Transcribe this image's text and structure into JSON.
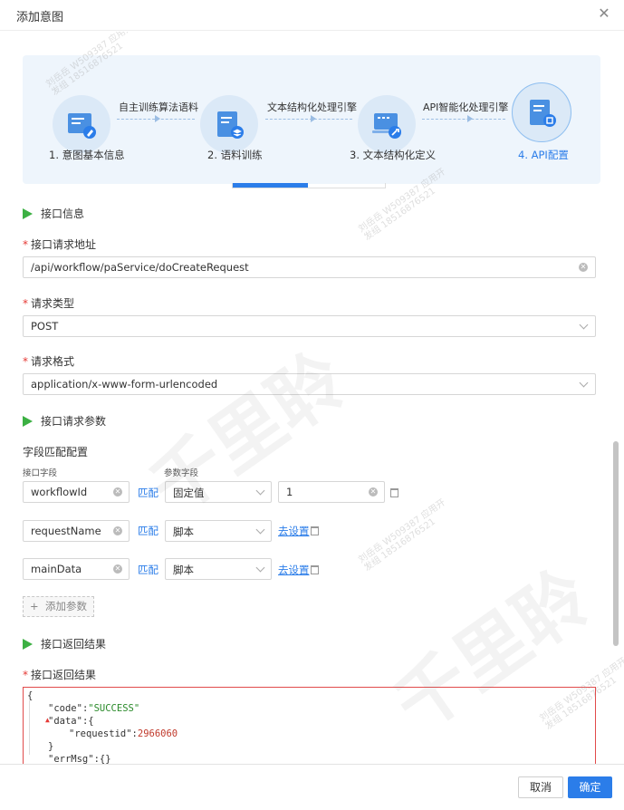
{
  "dialog": {
    "title": "添加意图",
    "close_icon": "close-icon"
  },
  "steps": [
    {
      "label": "1. 意图基本信息",
      "icon": "edit-document-icon",
      "active": false
    },
    {
      "label": "2. 语料训练",
      "icon": "layers-document-icon",
      "active": false
    },
    {
      "label": "3. 文本结构化定义",
      "icon": "laptop-tool-icon",
      "active": false
    },
    {
      "label": "4. API配置",
      "icon": "api-document-icon",
      "active": true
    }
  ],
  "connectors": [
    "自主训练算法语料",
    "文本结构化处理引擎",
    "API智能化处理引擎"
  ],
  "sections": {
    "interface_info": "接口信息",
    "request_params": "接口请求参数",
    "response": "接口返回结果"
  },
  "form": {
    "url_label": "接口请求地址",
    "url_value": "/api/workflow/paService/doCreateRequest",
    "type_label": "请求类型",
    "type_value": "POST",
    "format_label": "请求格式",
    "format_value": "application/x-www-form-urlencoded"
  },
  "mapping": {
    "title": "字段匹配配置",
    "col_interface": "接口字段",
    "col_param": "参数字段",
    "match_label": "匹配",
    "rows": [
      {
        "field": "workflowId",
        "param_type": "固定值",
        "value": "1",
        "link": ""
      },
      {
        "field": "requestName",
        "param_type": "脚本",
        "value": "",
        "link": "去设置"
      },
      {
        "field": "mainData",
        "param_type": "脚本",
        "value": "",
        "link": "去设置"
      }
    ],
    "add_label": "添加参数",
    "add_symbol": "+"
  },
  "response": {
    "label": "接口返回结果",
    "code_lines": [
      {
        "indent": 0,
        "text": "{"
      },
      {
        "indent": 1,
        "key": "\"code\"",
        "sep": ":",
        "str": "\"SUCCESS\""
      },
      {
        "indent": 1,
        "key": "\"data\"",
        "sep": ":{"
      },
      {
        "indent": 2,
        "key": "\"requestid\"",
        "sep": ":",
        "num": "2966060"
      },
      {
        "indent": 1,
        "text": "}"
      },
      {
        "indent": 1,
        "key": "\"errMsg\"",
        "sep": ":{}"
      }
    ]
  },
  "footer": {
    "cancel": "取消",
    "ok": "确定"
  },
  "watermark": {
    "big": "千里聆",
    "small": "刘岳岳 W509387 应用开\n发组 18516876521"
  },
  "colors": {
    "primary": "#2b7de9",
    "flag": "#3cb043",
    "required": "#e53935",
    "step_bg": "#eef5fc"
  }
}
